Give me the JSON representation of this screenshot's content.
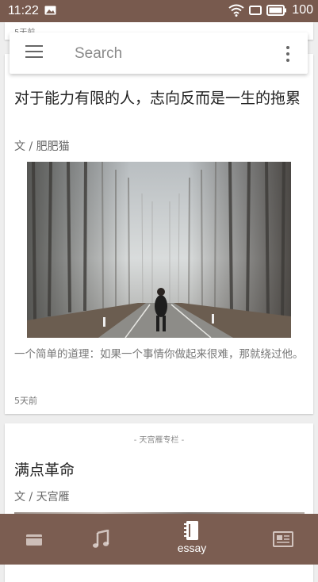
{
  "status": {
    "time": "11:22",
    "battery": "100"
  },
  "search": {
    "placeholder": "Search"
  },
  "feed": {
    "prev_card": {
      "date": "5天前"
    },
    "main_card": {
      "title": "对于能力有限的人，志向反而是一生的拖累",
      "author": "文 / 肥肥猫",
      "excerpt": "一个简单的道理：如果一个事情你做起来很难，那就绕过他。",
      "date": "5天前"
    },
    "next_card": {
      "column": "- 天宫雁专栏 -",
      "title": "满点革命",
      "author": "文 / 天宫雁"
    }
  },
  "bottom_nav": {
    "items": [
      {
        "icon": "card-icon",
        "label": ""
      },
      {
        "icon": "music-note-icon",
        "label": ""
      },
      {
        "icon": "notebook-icon",
        "label": "essay"
      },
      {
        "icon": "newspaper-icon",
        "label": ""
      }
    ]
  },
  "colors": {
    "bar": "#785a4e",
    "nav": "#7b5d51"
  }
}
